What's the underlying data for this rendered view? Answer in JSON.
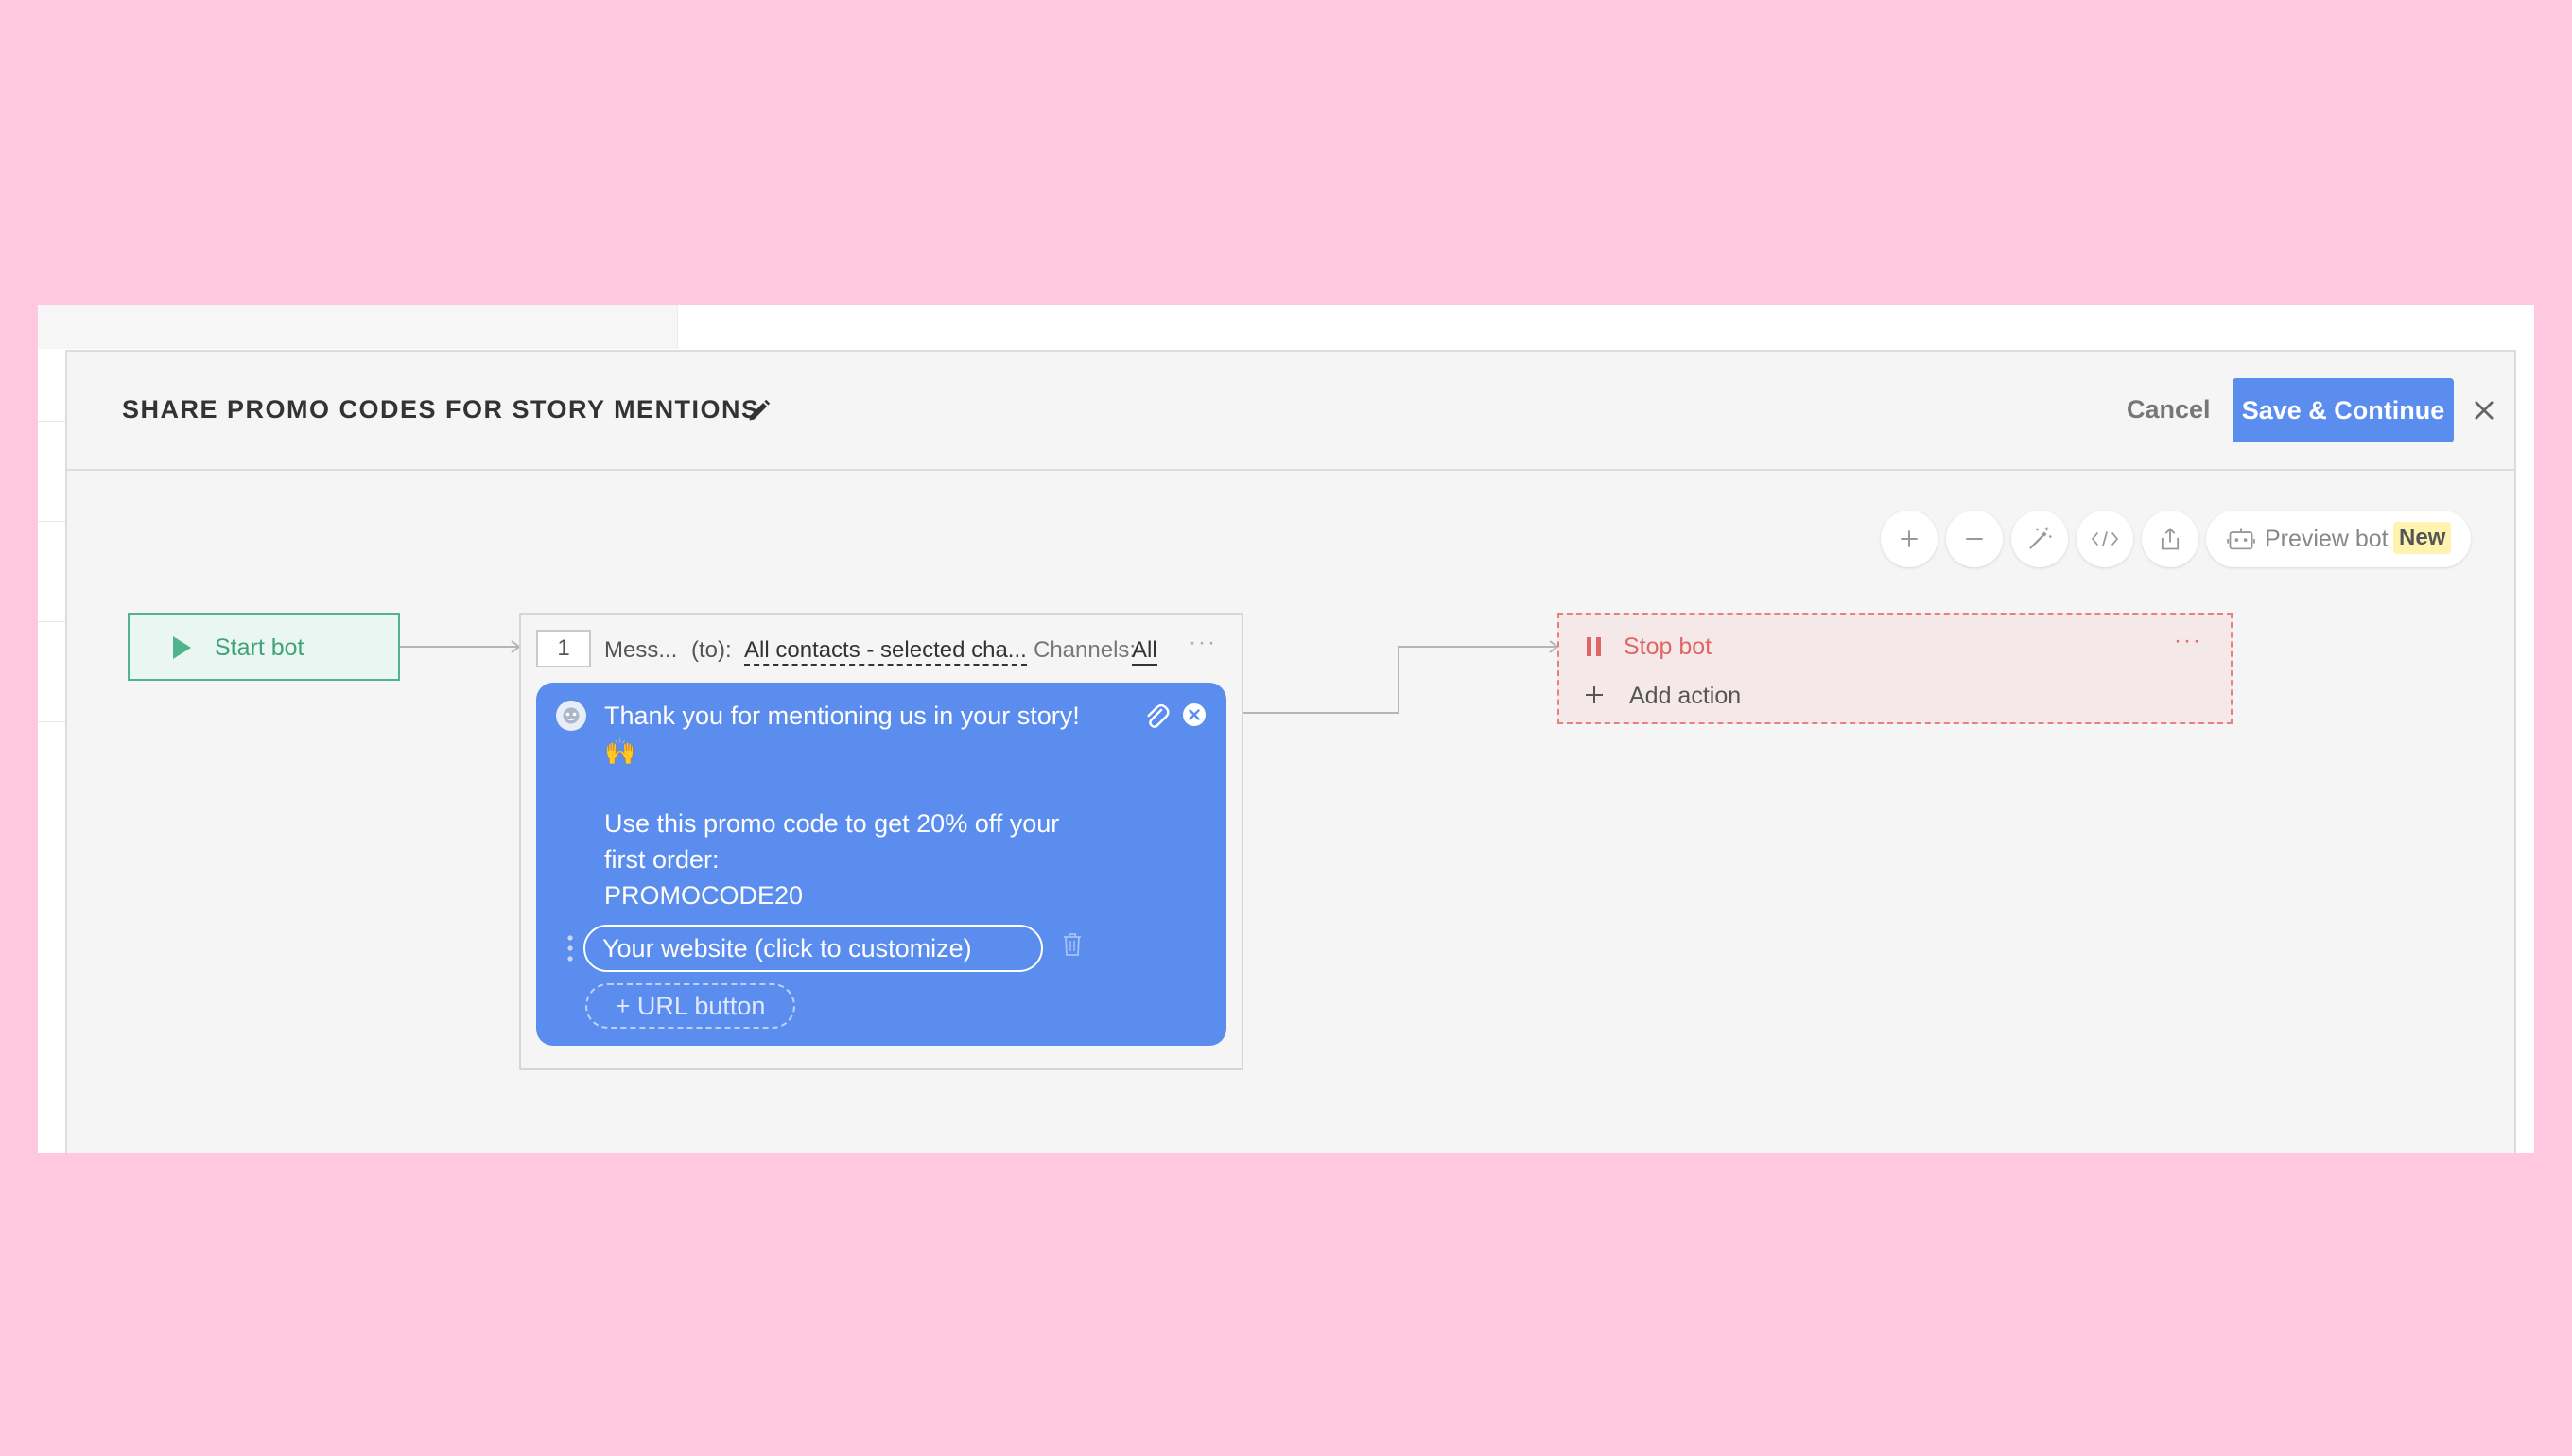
{
  "header": {
    "title": "SHARE PROMO CODES FOR STORY MENTIONS",
    "cancel_label": "Cancel",
    "save_label": "Save & Continue"
  },
  "toolbar": {
    "preview_label": "Preview bot",
    "new_badge": "New",
    "icons": [
      "plus-icon",
      "minus-icon",
      "magic-wand-icon",
      "code-icon",
      "export-icon",
      "bot-icon"
    ]
  },
  "start_node": {
    "label": "Start bot"
  },
  "message_node": {
    "step_number": "1",
    "type_label": "Mess...",
    "to_label": "(to):",
    "audience": "All contacts - selected cha...",
    "channels_label": "Channels:",
    "channels_value": "All",
    "more": "···",
    "message_lines": [
      "Thank you for mentioning us in your story!",
      "🙌",
      "",
      "Use this promo code to get 20% off your",
      "first order:",
      "PROMOCODE20"
    ],
    "url_button_label": "Your website (click to customize)",
    "add_url_label": "+ URL button"
  },
  "stop_node": {
    "label": "Stop bot",
    "more": "···",
    "add_action_label": "Add action"
  },
  "colors": {
    "accent": "#5b8dee",
    "start_green": "#4fb38d",
    "stop_red": "#e06666",
    "page_bg": "#ffc8df"
  }
}
